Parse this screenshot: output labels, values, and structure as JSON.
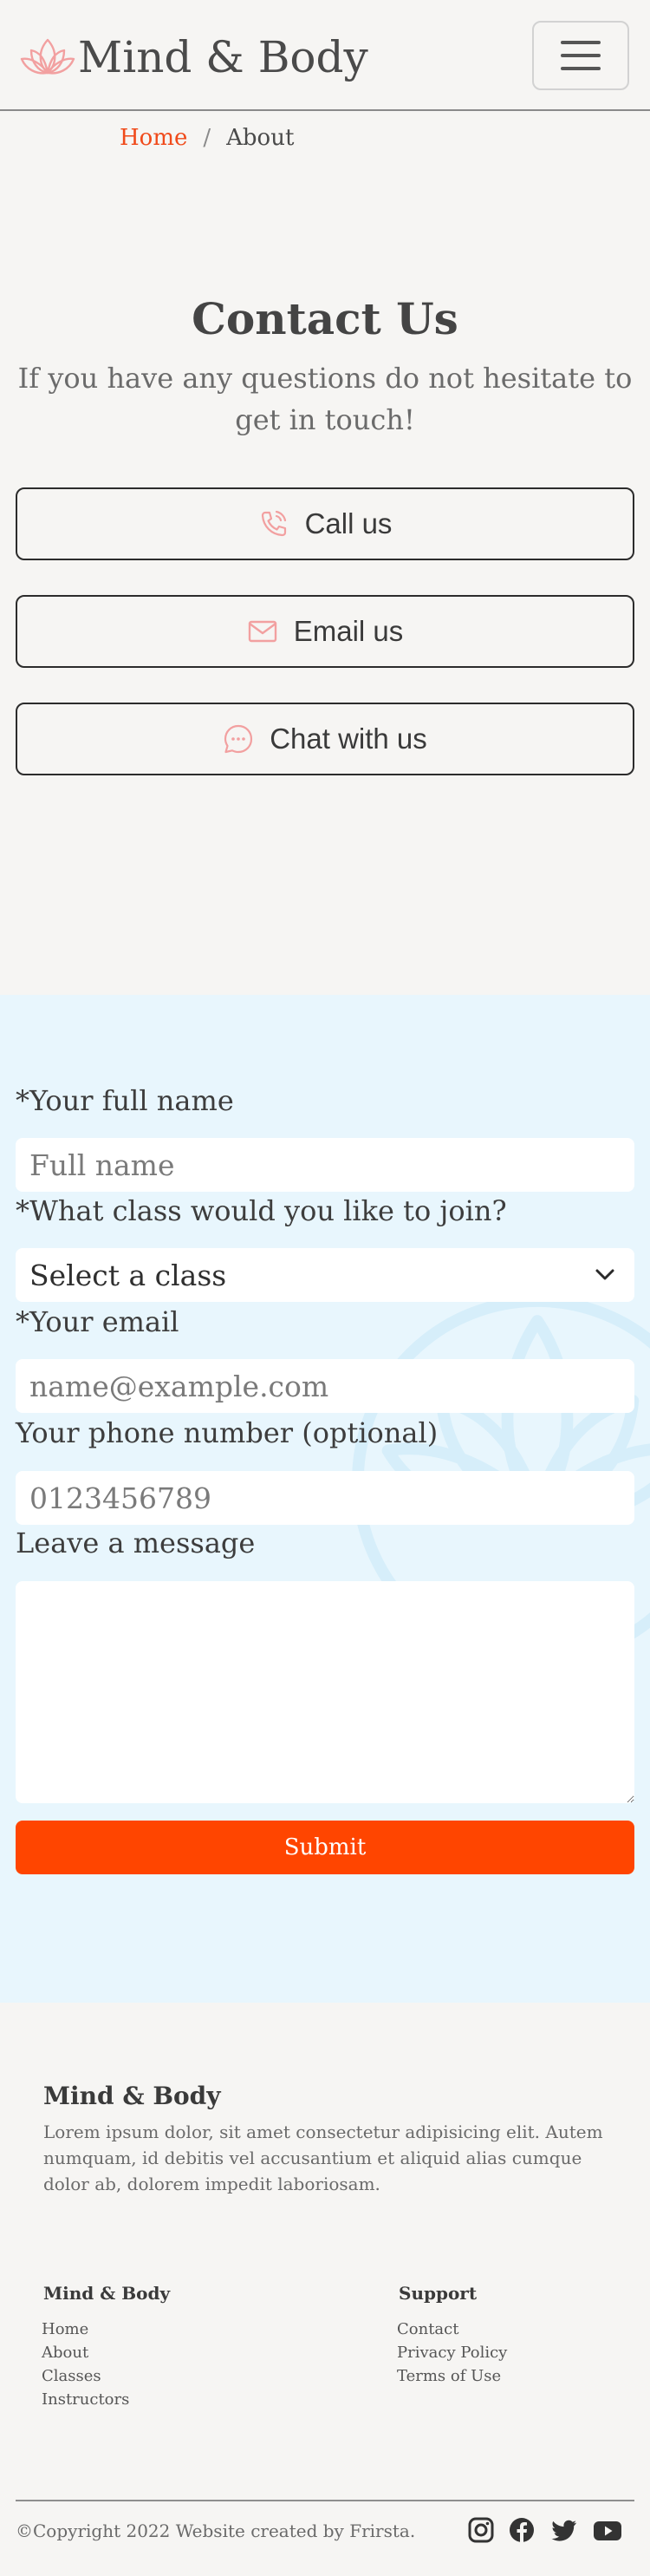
{
  "header": {
    "brand": "Mind & Body",
    "logo_icon": "lotus-icon",
    "menu_icon": "hamburger-menu-icon"
  },
  "breadcrumb": {
    "home": "Home",
    "separator": "/",
    "current": "About"
  },
  "contact": {
    "title": "Contact Us",
    "subtitle": "If you have any questions do not hesitate to get in touch!",
    "buttons": [
      {
        "label": "Call us",
        "icon": "phone-icon"
      },
      {
        "label": "Email us",
        "icon": "envelope-icon"
      },
      {
        "label": "Chat with us",
        "icon": "chat-bubble-icon"
      }
    ]
  },
  "form": {
    "name_label": "*Your full name",
    "name_placeholder": "Full name",
    "class_label": "*What class would you like to join?",
    "class_selected": "Select a class",
    "email_label": "*Your email",
    "email_placeholder": "name@example.com",
    "phone_label": "Your phone number (optional)",
    "phone_placeholder": "0123456789",
    "message_label": "Leave a message",
    "submit_label": "Submit"
  },
  "footer": {
    "title": "Mind & Body",
    "description": "Lorem ipsum dolor, sit amet consectetur adipisicing elit. Autem numquam, id debitis vel accusantium et aliquid alias cumque dolor ab, dolorem impedit laboriosam.",
    "columns": [
      {
        "title": "Mind & Body",
        "links": [
          "Home",
          "About",
          "Classes",
          "Instructors"
        ]
      },
      {
        "title": "Support",
        "links": [
          "Contact",
          "Privacy Policy",
          "Terms of Use"
        ]
      }
    ],
    "copyright": "©Copyright 2022 Website created by Frirsta.",
    "social_icons": [
      "instagram-icon",
      "facebook-icon",
      "twitter-icon",
      "youtube-icon"
    ]
  },
  "colors": {
    "accent": "#ff4500",
    "link": "#f04a1a",
    "icon_pink": "#f2a0a0",
    "form_bg": "#e8f6fd",
    "page_bg": "#f6f5f3"
  }
}
